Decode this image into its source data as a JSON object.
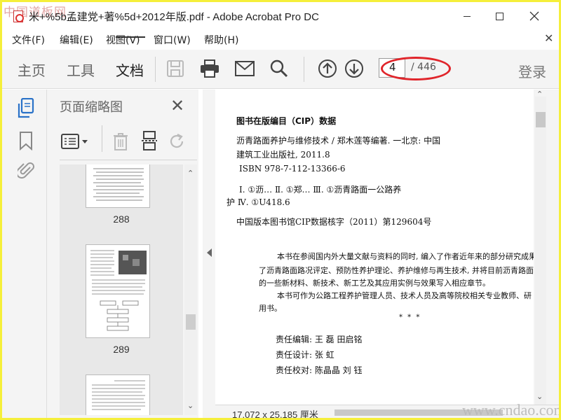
{
  "window": {
    "title": "米+%5b孟建党+著%5d+2012年版.pdf - Adobe Acrobat Pro DC",
    "watermark_top": "中国道板网",
    "watermark_bottom": "www.cndao.com"
  },
  "menu": {
    "items": [
      "文件(F)",
      "编辑(E)",
      "视图(V)",
      "窗口(W)",
      "帮助(H)"
    ]
  },
  "toolbar": {
    "tabs": [
      "主页",
      "工具",
      "文档"
    ],
    "active_tab": "文档",
    "page_current": "4",
    "page_total": "/ 446",
    "login_label": "登录",
    "highlight_color": "#e0252b"
  },
  "thumbnails": {
    "title": "页面缩略图",
    "pages": [
      {
        "label": "288"
      },
      {
        "label": "289"
      },
      {
        "label": ""
      }
    ]
  },
  "document": {
    "cip_heading": "图书在版编目（CIP）数据",
    "cip_line1": "沥青路面养护与维修技术 / 郑木莲等编著. 一北京: 中国",
    "cip_line2": "建筑工业出版社, 2011.8",
    "cip_line3": "ISBN 978-7-112-13366-6",
    "cip_line4": "Ⅰ. ①沥…  Ⅱ. ①郑…  Ⅲ. ①沥青路面一公路养",
    "cip_line5": "护  Ⅳ. ①U418.6",
    "cip_line6": "中国版本图书馆CIP数据核字（2011）第129604号",
    "para1_line1": "本书在参阅国内外大量文献与资料的同时, 编入了作者近年来的部分研究成果",
    "para1_line2": "了沥青路面路况评定、预防性养护理论、养护维修与再生技术, 并将目前沥青路面",
    "para1_line3": "的一些新材料、新技术、新工艺及其应用实例与效果写入相应章节。",
    "para2_line1": "本书可作为公路工程养护管理人员、技术人员及高等院校相关专业教师、研",
    "para2_line2": "用书。",
    "stars": "*     *     *",
    "editor_label": "责任编辑: 王  磊  田启铭",
    "designer_label": "责任设计: 张  虹",
    "proof_label": "责任校对: 陈晶晶  刘  钰"
  },
  "status": {
    "page_size": "17.072 x 25.185 厘米"
  }
}
